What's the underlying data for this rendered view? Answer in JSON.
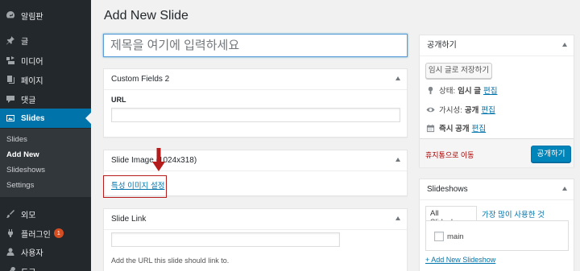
{
  "sidebar": {
    "items": [
      {
        "label": "알림판",
        "icon": "dashboard-icon"
      },
      {
        "label": "글",
        "icon": "pin-icon"
      },
      {
        "label": "미디어",
        "icon": "media-icon"
      },
      {
        "label": "페이지",
        "icon": "page-icon"
      },
      {
        "label": "댓글",
        "icon": "comment-icon"
      },
      {
        "label": "Slides",
        "icon": "slides-icon"
      },
      {
        "label": "외모",
        "icon": "brush-icon"
      },
      {
        "label": "플러그인",
        "icon": "plugin-icon",
        "badge": "1"
      },
      {
        "label": "사용자",
        "icon": "user-icon"
      },
      {
        "label": "도구",
        "icon": "tools-icon"
      }
    ],
    "submenu": [
      "Slides",
      "Add New",
      "Slideshows",
      "Settings"
    ],
    "active_color": "#0073aa"
  },
  "page": {
    "title": "Add New Slide",
    "title_placeholder": "제목을 여기에 입력하세요"
  },
  "custom_fields": {
    "heading": "Custom Fields 2",
    "url_label": "URL"
  },
  "slide_image": {
    "heading": "Slide Image (1024x318)",
    "set_link": "특성 이미지 설정"
  },
  "slide_link": {
    "heading": "Slide Link",
    "help": "Add the URL this slide should link to."
  },
  "publish": {
    "heading": "공개하기",
    "save_draft": "임시 글로 저장하기",
    "status_label": "상태:",
    "status_value": "임시 글",
    "visibility_label": "가시성:",
    "visibility_value": "공개",
    "schedule": "즉시 공개",
    "edit": "편집",
    "trash": "휴지통으로 이동",
    "publish_button": "공개하기"
  },
  "slideshows": {
    "heading": "Slideshows",
    "tab_all": "All Slideshows",
    "tab_popular": "가장 많이 사용한 것",
    "item": "main",
    "add_new": "+ Add New Slideshow"
  }
}
